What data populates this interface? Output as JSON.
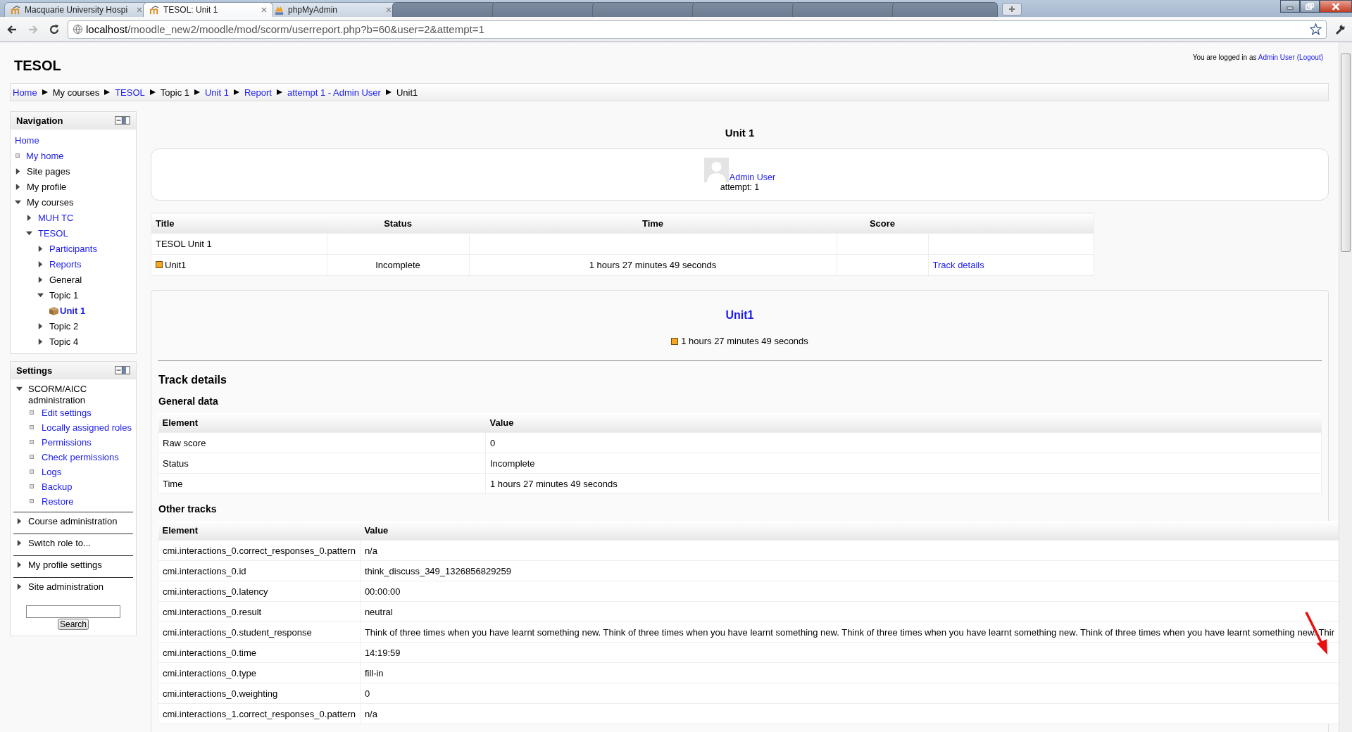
{
  "browser": {
    "tabs": [
      {
        "label": "Macquarie University Hospi",
        "selected": false,
        "kind": "moodle"
      },
      {
        "label": "TESOL: Unit 1",
        "selected": true,
        "kind": "moodle"
      },
      {
        "label": "phpMyAdmin",
        "selected": false,
        "kind": "pma"
      },
      {
        "selected": false,
        "kind": "blurred"
      },
      {
        "selected": false,
        "kind": "blurred"
      },
      {
        "selected": false,
        "kind": "blurred"
      },
      {
        "selected": false,
        "kind": "blurred"
      },
      {
        "selected": false,
        "kind": "blurred"
      },
      {
        "selected": false,
        "kind": "blurred"
      }
    ],
    "address": {
      "host": "localhost",
      "path": "/moodle_new2/moodle/mod/scorm/userreport.php?b=60&user=2&attempt=1"
    }
  },
  "site_title": "TESOL",
  "login_info": [
    {
      "text": "You are logged in as",
      "link": false
    },
    {
      "text": "Admin User",
      "link": true
    },
    {
      "text": "(Logout)",
      "link": true
    }
  ],
  "breadcrumb": [
    {
      "label": "Home",
      "link": true
    },
    {
      "label": "My courses",
      "link": false
    },
    {
      "label": "TESOL",
      "link": true
    },
    {
      "label": "Topic 1",
      "link": false
    },
    {
      "label": "Unit 1",
      "link": true
    },
    {
      "label": "Report",
      "link": true
    },
    {
      "label": "attempt 1 - Admin User",
      "link": true
    },
    {
      "label": "Unit1",
      "link": false
    }
  ],
  "navigation": {
    "title": "Navigation",
    "items": [
      {
        "label": "Home",
        "kind": "root",
        "link": true
      },
      {
        "label": "My home",
        "kind": "leaf",
        "link": true
      },
      {
        "label": "Site pages",
        "kind": "branch",
        "link": false,
        "expanded": false
      },
      {
        "label": "My profile",
        "kind": "branch",
        "link": false,
        "expanded": false
      },
      {
        "label": "My courses",
        "kind": "branch",
        "link": false,
        "expanded": true,
        "children": [
          {
            "label": "MUH TC",
            "kind": "branch",
            "link": true,
            "expanded": false
          },
          {
            "label": "TESOL",
            "kind": "branch",
            "link": true,
            "expanded": true,
            "children": [
              {
                "label": "Participants",
                "kind": "branch",
                "link": true,
                "expanded": false
              },
              {
                "label": "Reports",
                "kind": "branch",
                "link": true,
                "expanded": false
              },
              {
                "label": "General",
                "kind": "branch",
                "link": false,
                "expanded": false
              },
              {
                "label": "Topic 1",
                "kind": "branch",
                "link": false,
                "expanded": true,
                "children": [
                  {
                    "label": "Unit 1",
                    "kind": "activity",
                    "link": true
                  }
                ]
              },
              {
                "label": "Topic 2",
                "kind": "branch",
                "link": false,
                "expanded": false
              },
              {
                "label": "Topic 4",
                "kind": "branch",
                "link": false,
                "expanded": false
              }
            ]
          }
        ]
      }
    ]
  },
  "settings": {
    "title": "Settings",
    "items": [
      {
        "label": "SCORM/AICC administration",
        "kind": "branch",
        "link": false,
        "expanded": true,
        "children": [
          {
            "label": "Edit settings",
            "kind": "leaf",
            "link": true
          },
          {
            "label": "Locally assigned roles",
            "kind": "leaf",
            "link": true
          },
          {
            "label": "Permissions",
            "kind": "leaf",
            "link": true
          },
          {
            "label": "Check permissions",
            "kind": "leaf",
            "link": true
          },
          {
            "label": "Logs",
            "kind": "leaf",
            "link": true
          },
          {
            "label": "Backup",
            "kind": "leaf",
            "link": true
          },
          {
            "label": "Restore",
            "kind": "leaf",
            "link": true
          }
        ]
      },
      {
        "label": "Course administration",
        "kind": "branch",
        "link": false,
        "expanded": false
      },
      {
        "label": "Switch role to...",
        "kind": "branch",
        "link": false,
        "expanded": false
      },
      {
        "label": "My profile settings",
        "kind": "branch",
        "link": false,
        "expanded": false
      },
      {
        "label": "Site administration",
        "kind": "branch",
        "link": false,
        "expanded": false
      }
    ],
    "search_button": "Search"
  },
  "page_heading": "Unit 1",
  "user": {
    "name": "Admin User",
    "attempt": "attempt: 1"
  },
  "summary_table": {
    "columns": [
      "Title",
      "Status",
      "Time",
      "Score"
    ],
    "rows": [
      {
        "kind": "organization",
        "title": "TESOL Unit 1"
      },
      {
        "kind": "sco",
        "title": "Unit1",
        "status": "Incomplete",
        "time": "1 hours 27 minutes 49 seconds",
        "link": "Track details"
      }
    ]
  },
  "sco": {
    "title": "Unit1",
    "time": "1 hours 27 minutes 49 seconds"
  },
  "track_details": {
    "title": "Track details",
    "general": {
      "title": "General data",
      "columns": [
        "Element",
        "Value"
      ],
      "rows": [
        [
          "Raw score",
          "0"
        ],
        [
          "Status",
          "Incomplete"
        ],
        [
          "Time",
          "1 hours 27 minutes 49 seconds"
        ]
      ]
    },
    "other": {
      "title": "Other tracks",
      "columns": [
        "Element",
        "Value"
      ],
      "rows": [
        [
          "cmi.interactions_0.correct_responses_0.pattern",
          "n/a"
        ],
        [
          "cmi.interactions_0.id",
          "think_discuss_349_1326856829259"
        ],
        [
          "cmi.interactions_0.latency",
          "00:00:00"
        ],
        [
          "cmi.interactions_0.result",
          "neutral"
        ],
        [
          "cmi.interactions_0.student_response",
          "Think of three times when you have learnt something new. Think of three times when you have learnt something new. Think of three times when you have learnt something new. Think of three times when you have learnt something new. Thir"
        ],
        [
          "cmi.interactions_0.time",
          "14:19:59"
        ],
        [
          "cmi.interactions_0.type",
          "fill-in"
        ],
        [
          "cmi.interactions_0.weighting",
          "0"
        ],
        [
          "cmi.interactions_1.correct_responses_0.pattern",
          "n/a"
        ]
      ]
    }
  }
}
